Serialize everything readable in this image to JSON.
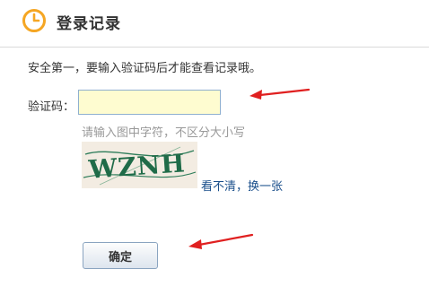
{
  "header": {
    "title": "登录记录",
    "icon": "clock-icon",
    "accent": "#f5a623"
  },
  "notice": "安全第一，要输入验证码后才能查看记录哦。",
  "form": {
    "captcha_label": "验证码：",
    "captcha_value": "",
    "hint": "请输入图中字符，不区分大小写",
    "captcha_text": "WZNH",
    "refresh_unclear": "看不清",
    "separator": "，",
    "refresh_change": "换一张",
    "confirm_label": "确定"
  },
  "colors": {
    "arrow": "#e02020",
    "link": "#1a4f8b",
    "input_bg": "#fefcd0"
  }
}
